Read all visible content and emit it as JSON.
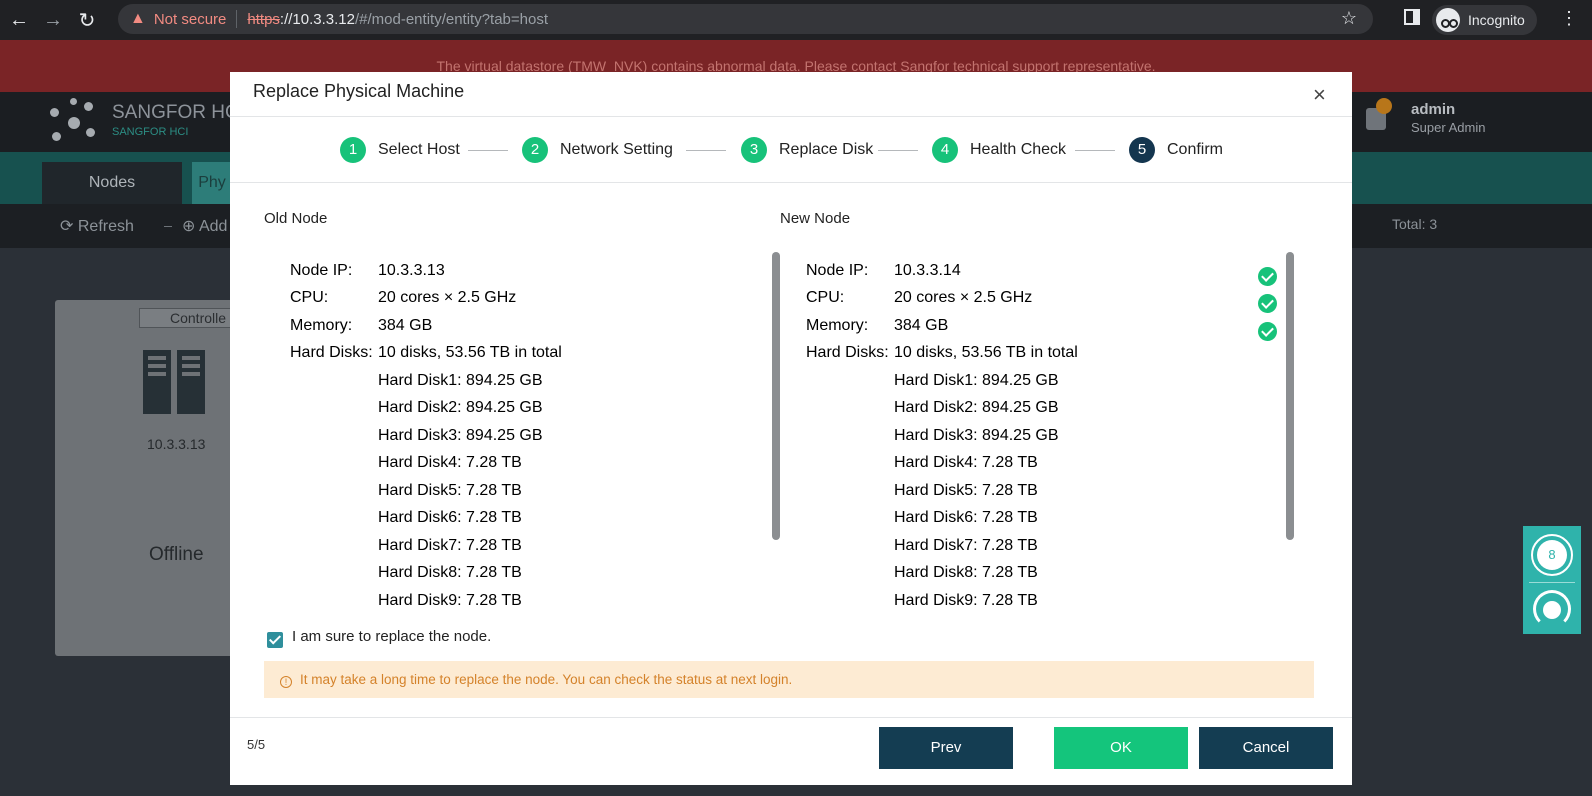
{
  "browser": {
    "back_icon": "←",
    "forward_icon": "→",
    "reload_icon": "↻",
    "warning_icon": "▲",
    "security_label": "Not secure",
    "url_scheme": "https",
    "url_host": "://10.3.3.12",
    "url_path": "/#/mod-entity/entity?tab=host",
    "star_icon": "☆",
    "incognito_label": "Incognito",
    "menu_icon": "⋮"
  },
  "background": {
    "banner_text": "The virtual datastore (TMW_NVK) contains abnormal data. Please contact Sangfor technical support representative.",
    "brand": "SANGFOR HC",
    "brand_sub": "SANGFOR HCI",
    "user_name": "admin",
    "user_role": "Super Admin",
    "tabs": [
      "Nodes",
      "Phy"
    ],
    "toolbar": {
      "refresh": "Refresh",
      "add": "Add",
      "total": "Total: 3"
    },
    "node_card": {
      "tag": "Controlle",
      "ip": "10.3.3.13",
      "status": "Offline"
    },
    "widget_count": "8"
  },
  "modal": {
    "title": "Replace Physical Machine",
    "close_icon": "×",
    "steps": [
      {
        "num": "1",
        "label": "Select Host"
      },
      {
        "num": "2",
        "label": "Network Setting"
      },
      {
        "num": "3",
        "label": "Replace Disk"
      },
      {
        "num": "4",
        "label": "Health Check"
      },
      {
        "num": "5",
        "label": "Confirm"
      }
    ],
    "old_node": {
      "title": "Old Node",
      "labels": {
        "ip": "Node IP:",
        "cpu": "CPU:",
        "memory": "Memory:",
        "disks": "Hard Disks:"
      },
      "ip": "10.3.3.13",
      "cpu": "20 cores × 2.5 GHz",
      "memory": "384 GB",
      "disks": "10 disks, 53.56 TB in total",
      "disk_list": [
        "Hard Disk1: 894.25 GB",
        "Hard Disk2: 894.25 GB",
        "Hard Disk3: 894.25 GB",
        "Hard Disk4: 7.28 TB",
        "Hard Disk5: 7.28 TB",
        "Hard Disk6: 7.28 TB",
        "Hard Disk7: 7.28 TB",
        "Hard Disk8: 7.28 TB",
        "Hard Disk9: 7.28 TB"
      ]
    },
    "new_node": {
      "title": "New Node",
      "labels": {
        "ip": "Node IP:",
        "cpu": "CPU:",
        "memory": "Memory:",
        "disks": "Hard Disks:"
      },
      "ip": "10.3.3.14",
      "cpu": "20 cores × 2.5 GHz",
      "memory": "384 GB",
      "disks": "10 disks, 53.56 TB in total",
      "disk_list": [
        "Hard Disk1: 894.25 GB",
        "Hard Disk2: 894.25 GB",
        "Hard Disk3: 894.25 GB",
        "Hard Disk4: 7.28 TB",
        "Hard Disk5: 7.28 TB",
        "Hard Disk6: 7.28 TB",
        "Hard Disk7: 7.28 TB",
        "Hard Disk8: 7.28 TB",
        "Hard Disk9: 7.28 TB"
      ]
    },
    "confirm_label": "I am sure to replace the node.",
    "notice_icon": "!",
    "notice": "It may take a long time to replace the node. You can check the status at next login.",
    "page_indicator": "5/5",
    "buttons": {
      "prev": "Prev",
      "ok": "OK",
      "cancel": "Cancel"
    }
  },
  "colors": {
    "accent_green": "#17c27a",
    "navy": "#143d52",
    "warning_bg": "#fdebd3",
    "warning_text": "#d4822a"
  }
}
